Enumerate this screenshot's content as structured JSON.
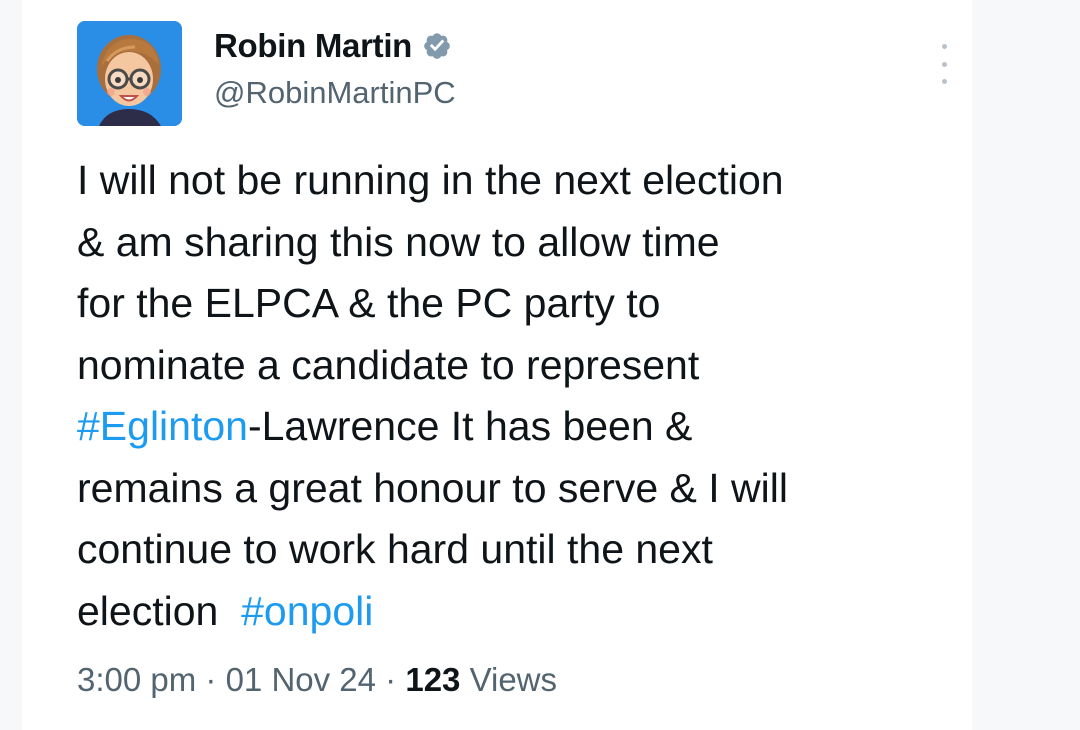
{
  "author": {
    "display_name": "Robin Martin",
    "handle": "@RobinMartinPC",
    "verified": true,
    "avatar_icon": "memoji-avatar-icon",
    "verified_icon": "verified-badge-icon"
  },
  "menu": {
    "icon": "more-options-icon"
  },
  "tweet": {
    "lines": [
      {
        "segments": [
          {
            "text": "I will not be running in the next election",
            "hashtag": false
          }
        ]
      },
      {
        "segments": [
          {
            "text": "& am sharing this now to allow time",
            "hashtag": false
          }
        ]
      },
      {
        "segments": [
          {
            "text": "for the ELPCA & the PC party to",
            "hashtag": false
          }
        ]
      },
      {
        "segments": [
          {
            "text": "nominate a candidate to represent",
            "hashtag": false
          }
        ]
      },
      {
        "segments": [
          {
            "text": "#Eglinton",
            "hashtag": true
          },
          {
            "text": "-Lawrence It has been &",
            "hashtag": false
          }
        ]
      },
      {
        "segments": [
          {
            "text": "remains a great honour to serve & I will",
            "hashtag": false
          }
        ]
      },
      {
        "segments": [
          {
            "text": "continue to work hard until the next",
            "hashtag": false
          }
        ]
      },
      {
        "segments": [
          {
            "text": "election  ",
            "hashtag": false
          },
          {
            "text": "#onpoli",
            "hashtag": true
          }
        ]
      }
    ]
  },
  "meta": {
    "time": "3:00 pm",
    "separator": " · ",
    "date": "01 Nov 24",
    "views_count": "123",
    "views_label": " Views"
  },
  "colors": {
    "hashtag": "#1d9bf0",
    "text": "#0f1419",
    "secondary": "#536471",
    "avatar_bg": "#2b8ee6",
    "verified_badge": "#829aab"
  }
}
